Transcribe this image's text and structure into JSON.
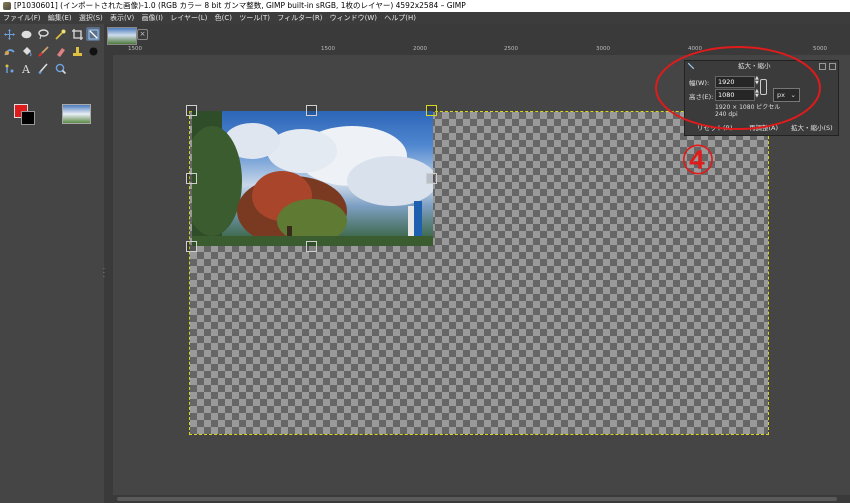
{
  "window": {
    "title": "[P1030601] (インポートされた画像)-1.0 (RGB カラー 8 bit ガンマ整数, GIMP built-in sRGB, 1枚のレイヤー) 4592x2584 – GIMP"
  },
  "menubar": {
    "items": [
      "ファイル(F)",
      "編集(E)",
      "選択(S)",
      "表示(V)",
      "画像(I)",
      "レイヤー(L)",
      "色(C)",
      "ツール(T)",
      "フィルター(R)",
      "ウィンドウ(W)",
      "ヘルプ(H)"
    ]
  },
  "ruler": {
    "ticks": [
      "1500",
      "",
      "1000",
      "",
      "",
      "",
      "1500",
      "",
      "2000",
      "",
      "2500",
      "",
      "3000",
      "",
      "",
      "4000",
      "",
      "",
      "",
      "5000"
    ]
  },
  "scale_dialog": {
    "title": "拡大・縮小",
    "width_label": "幅(W):",
    "width_value": "1920",
    "height_label": "高さ(E):",
    "height_value": "1080",
    "unit": "px",
    "pixel_info": "1920 × 1080 ピクセル",
    "dpi_info": "240 dpi",
    "reset_button": "リセット(R)",
    "adjust_button": "再調整(A)",
    "scale_button": "拡大・縮小(S)"
  },
  "annotation": {
    "number": "④",
    "color": "#e01b1b"
  },
  "colors": {
    "foreground": "#e01b1b",
    "background": "#000000"
  }
}
